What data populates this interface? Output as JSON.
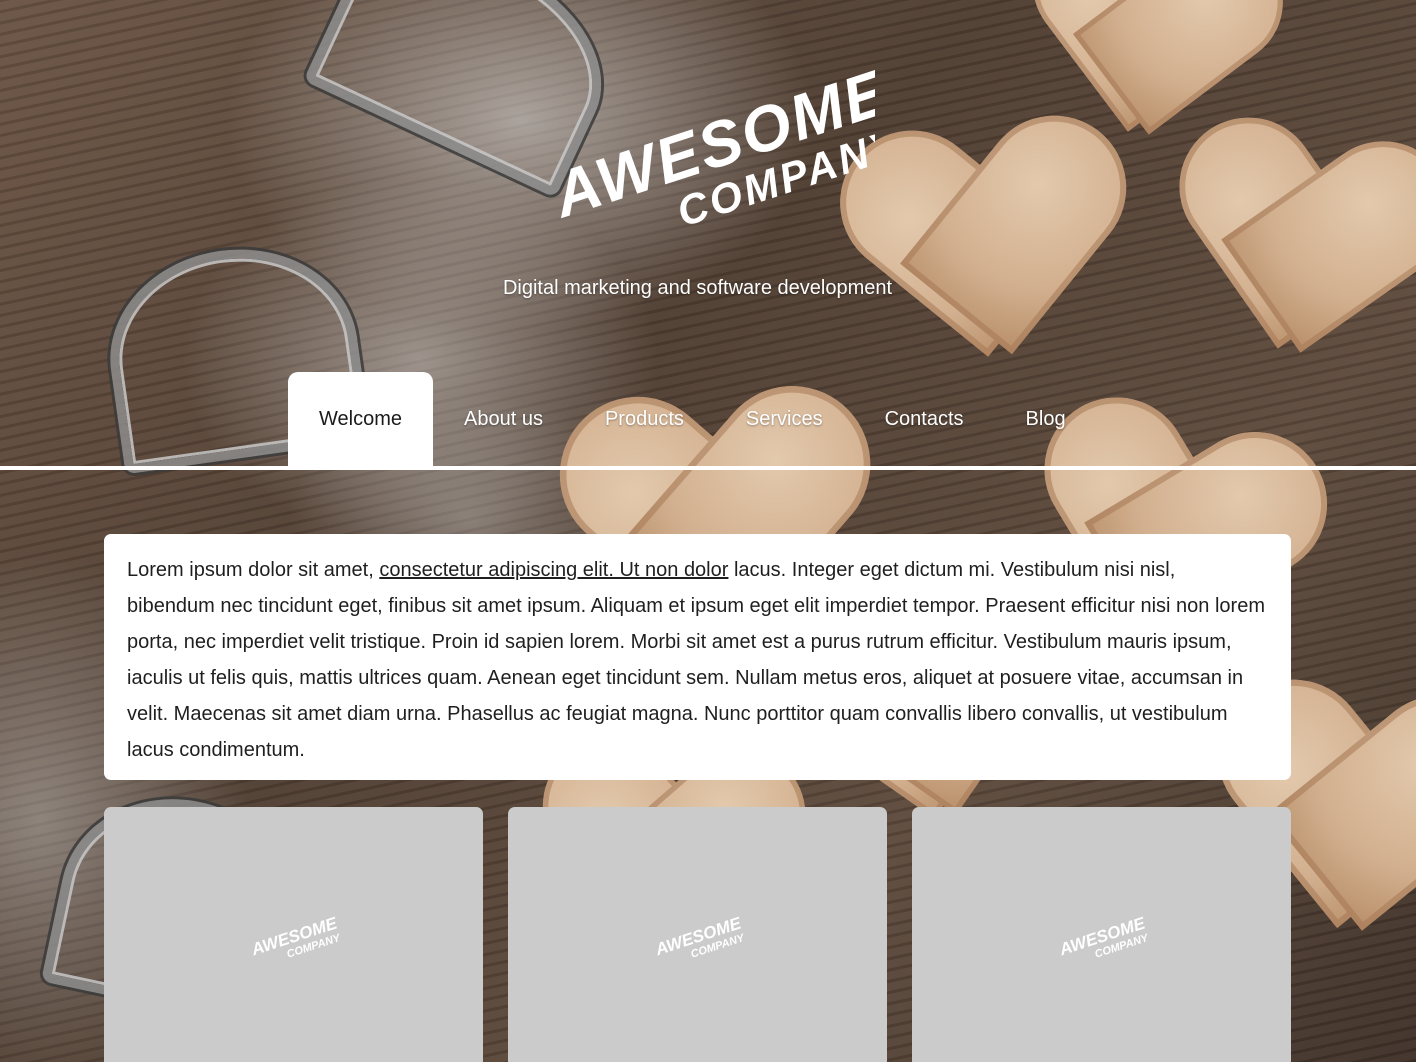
{
  "brand": {
    "name_line1": "Awesome",
    "name_line2": "Company",
    "tagline": "Digital marketing and software development"
  },
  "nav": {
    "items": [
      {
        "label": "Welcome",
        "active": true
      },
      {
        "label": "About us",
        "active": false
      },
      {
        "label": "Products",
        "active": false
      },
      {
        "label": "Services",
        "active": false
      },
      {
        "label": "Contacts",
        "active": false
      },
      {
        "label": "Blog",
        "active": false
      }
    ]
  },
  "intro": {
    "text_before_link": "Lorem ipsum dolor sit amet, ",
    "link_text": "consectetur adipiscing elit. Ut non dolor",
    "text_after_link": " lacus. Integer eget dictum mi. Vestibulum nisi nisl, bibendum nec tincidunt eget, finibus sit amet ipsum. Aliquam et ipsum eget elit imperdiet tempor. Praesent efficitur nisi non lorem porta, nec imperdiet velit tristique. Proin id sapien lorem. Morbi sit amet est a purus rutrum efficitur. Vestibulum mauris ipsum, iaculis ut felis quis, mattis ultrices quam. Aenean eget tincidunt sem. Nullam metus eros, aliquet at posuere vitae, accumsan in velit. Maecenas sit amet diam urna. Phasellus ac feugiat magna. Nunc porttitor quam convallis libero convallis, ut vestibulum lacus condimentum."
  },
  "cards": [
    {
      "placeholder": "logo-placeholder"
    },
    {
      "placeholder": "logo-placeholder"
    },
    {
      "placeholder": "logo-placeholder"
    }
  ],
  "colors": {
    "nav_active_bg": "#ffffff",
    "card_placeholder_bg": "#cbcbcb",
    "text": "#1f1f1f"
  }
}
